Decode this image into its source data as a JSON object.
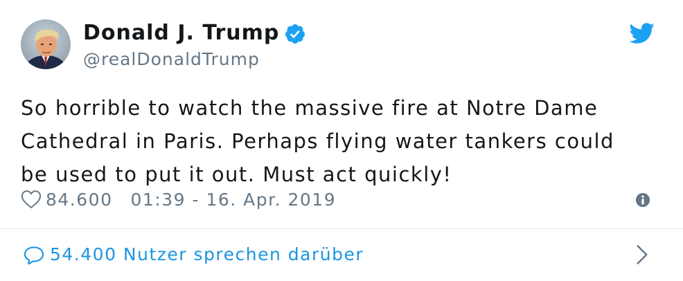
{
  "author": {
    "display_name": "Donald J. Trump",
    "handle": "@realDonaldTrump",
    "verified": true
  },
  "tweet": {
    "text_lines": [
      "So horrible to watch the massive fire at Notre Dame",
      "Cathedral in Paris. Perhaps flying water tankers could",
      "be used to put it out. Must act quickly!"
    ],
    "likes": "84.600",
    "timestamp": "01:39 - 16. Apr. 2019"
  },
  "conversation": {
    "label": "54.400 Nutzer sprechen darüber"
  },
  "icons": {
    "verified": "verified-badge-icon",
    "brand": "twitter-bird-icon",
    "like": "heart-icon",
    "info": "info-icon",
    "reply": "comment-icon",
    "chevron": "chevron-right-icon"
  },
  "colors": {
    "brand_blue": "#1da1f2",
    "link_blue": "#1b95e0",
    "text_primary": "#14171a",
    "text_secondary": "#657786",
    "divider": "#e6ecf0"
  }
}
